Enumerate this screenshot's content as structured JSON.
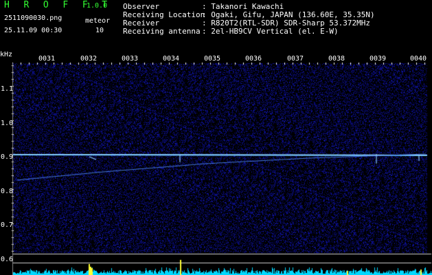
{
  "header": {
    "app_name": "H R O F F T",
    "version": "1.0.0",
    "filename": "2511090030.png",
    "datetime": "25.11.09 00:30",
    "meteor_label": "meteor",
    "meteor_count": "10"
  },
  "info": {
    "observer_label": "Observer",
    "observer_value": ": Takanori Kawachi",
    "location_label": "Receiving Location",
    "location_value": ": Ogaki, Gifu, JAPAN (136.60E, 35.35N)",
    "receiver_label": "Receiver",
    "receiver_value": ": R820T2(RTL-SDR) SDR-Sharp 53.372MHz",
    "antenna_label": "Receiving antenna",
    "antenna_value": ": 2el-HB9CV Vertical (el. E-W)"
  },
  "axis": {
    "unit_label": "kHz",
    "time_ticks": [
      "0031",
      "0032",
      "0033",
      "0034",
      "0035",
      "0036",
      "0037",
      "0038",
      "0039",
      "0040"
    ],
    "freq_ticks": [
      "1.1",
      "1.0",
      "0.9",
      "0.8",
      "0.7",
      "0.6"
    ]
  },
  "colors": {
    "background": "#000000",
    "text": "#ffffff",
    "logo": "#33ff33",
    "noise": "#1a1aa8",
    "carrier": "#66ccff",
    "power_trace": "#00d8ff",
    "burst": "#ffff33"
  }
}
